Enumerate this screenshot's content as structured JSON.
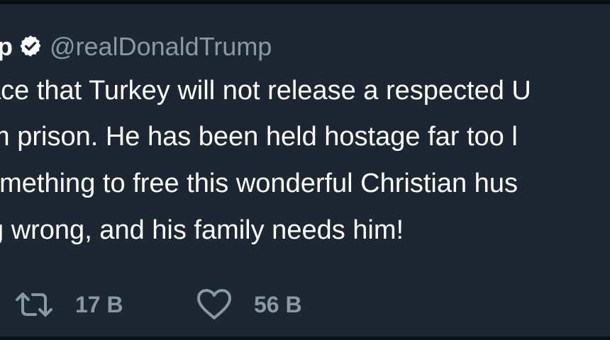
{
  "tweet": {
    "author_name": "rump",
    "handle": "@realDonaldTrump",
    "lines": [
      "ace that Turkey will not release a respected U",
      "m prison. He has been held hostage far too l",
      "omething to free this wonderful Christian hus",
      "g wrong, and his family needs him!"
    ]
  },
  "actions": {
    "retweet_count": "17 В",
    "like_count": "56 В"
  },
  "icons": {
    "verified": "verified-badge-icon",
    "retweet": "retweet-icon",
    "like": "heart-icon"
  },
  "colors": {
    "background": "#1c2733",
    "text": "#ffffff",
    "secondary": "#8899a6"
  }
}
